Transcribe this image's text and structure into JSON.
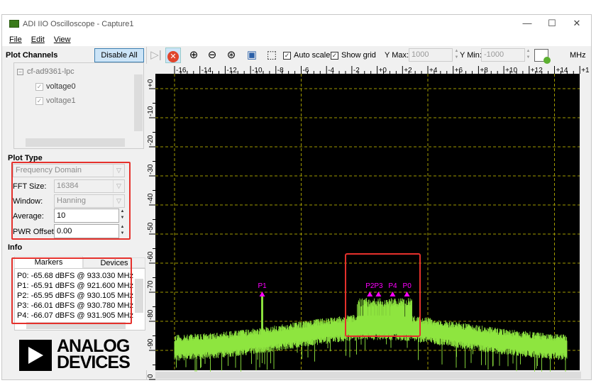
{
  "window": {
    "title": "ADI IIO Oscilloscope - Capture1",
    "controls": [
      "—",
      "☐",
      "✕"
    ]
  },
  "menu": [
    {
      "label": "File"
    },
    {
      "label": "Edit"
    },
    {
      "label": "View"
    }
  ],
  "plot_channels": {
    "title": "Plot Channels",
    "disable_all": "Disable All",
    "device": "cf-ad9361-lpc",
    "channels": [
      {
        "label": "voltage0",
        "checked": true
      },
      {
        "label": "voltage1",
        "checked": true
      }
    ]
  },
  "plot_type": {
    "title": "Plot Type",
    "domain": "Frequency Domain",
    "fft_size_label": "FFT Size:",
    "fft_size": "16384",
    "window_label": "Window:",
    "window": "Hanning",
    "average_label": "Average:",
    "average": "10",
    "pwr_offset_label": "PWR Offset:",
    "pwr_offset": "0.00"
  },
  "info": {
    "title": "Info",
    "tabs": [
      {
        "label": "Markers",
        "active": true
      },
      {
        "label": "Devices",
        "active": false
      }
    ],
    "markers": [
      "P0: -65.68 dBFS @ 933.030 MHz",
      "P1: -65.91 dBFS @ 921.600 MHz",
      "P2: -65.95 dBFS @ 930.105 MHz",
      "P3: -66.01 dBFS @ 930.780 MHz",
      "P4: -66.07 dBFS @ 931.905 MHz"
    ]
  },
  "logo": {
    "line1": "ANALOG",
    "line2": "DEVICES"
  },
  "toolbar": {
    "auto_scale_label": "Auto scale",
    "auto_scale": true,
    "show_grid_label": "Show grid",
    "show_grid": true,
    "ymax_label": "Y Max:",
    "ymax": "1000",
    "ymin_label": "Y Min:",
    "ymin": "-1000",
    "unit": "MHz"
  },
  "chart_data": {
    "type": "line",
    "x_ticks": [
      "-16",
      "-14",
      "-12",
      "-10",
      "-8",
      "-6",
      "-4",
      "-2",
      "+0",
      "+2",
      "+4",
      "+6",
      "+8",
      "+10",
      "+12",
      "+14",
      "+1"
    ],
    "y_ticks": [
      "+0",
      "-10",
      "-20",
      "-30",
      "-40",
      "-50",
      "-60",
      "-70",
      "-80",
      "-90",
      "0"
    ],
    "xlim": [
      -17.5,
      15.5
    ],
    "ylim": [
      -97,
      5
    ],
    "grid": true,
    "colors": {
      "trace": "#8ee53f",
      "grid": "#a09a00",
      "marker": "#ff00ff",
      "background": "#000000"
    },
    "markers": [
      {
        "label": "P0",
        "offset_mhz": 2.35,
        "dbfs": -65.68
      },
      {
        "label": "P1",
        "offset_mhz": -9.08,
        "dbfs": -65.91
      },
      {
        "label": "P2",
        "offset_mhz": -0.58,
        "dbfs": -65.95
      },
      {
        "label": "P3",
        "offset_mhz": 0.1,
        "dbfs": -66.01
      },
      {
        "label": "P4",
        "offset_mhz": 1.22,
        "dbfs": -66.07
      }
    ]
  }
}
